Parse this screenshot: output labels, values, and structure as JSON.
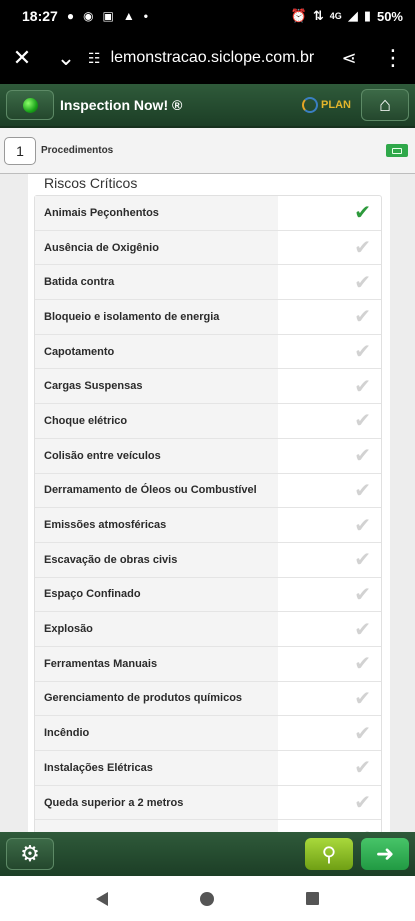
{
  "status": {
    "time": "18:27",
    "network": "4G",
    "battery": "50%"
  },
  "browser": {
    "url": "lemonstracao.siclope.com.br"
  },
  "header": {
    "title": "Inspection Now! ®",
    "brand": "PLAN"
  },
  "subheader": {
    "step": "1",
    "label": "Procedimentos"
  },
  "section": {
    "title": "Riscos Críticos"
  },
  "items": [
    {
      "label": "Animais Peçonhentos",
      "checked": true
    },
    {
      "label": "Ausência de Oxigênio",
      "checked": false
    },
    {
      "label": "Batida contra",
      "checked": false
    },
    {
      "label": "Bloqueio e isolamento de energia",
      "checked": false
    },
    {
      "label": "Capotamento",
      "checked": false
    },
    {
      "label": "Cargas Suspensas",
      "checked": false
    },
    {
      "label": "Choque elétrico",
      "checked": false
    },
    {
      "label": "Colisão entre veículos",
      "checked": false
    },
    {
      "label": "Derramamento de Óleos ou Combustível",
      "checked": false
    },
    {
      "label": "Emissões atmosféricas",
      "checked": false
    },
    {
      "label": "Escavação de obras civis",
      "checked": false
    },
    {
      "label": "Espaço Confinado",
      "checked": false
    },
    {
      "label": "Explosão",
      "checked": false
    },
    {
      "label": "Ferramentas Manuais",
      "checked": false
    },
    {
      "label": "Gerenciamento de produtos químicos",
      "checked": false
    },
    {
      "label": "Incêndio",
      "checked": false
    },
    {
      "label": "Instalações Elétricas",
      "checked": false
    },
    {
      "label": "Queda superior a 2 metros",
      "checked": false
    },
    {
      "label": "",
      "checked": false
    }
  ],
  "colors": {
    "header_green": "#2f5a3a",
    "check_on": "#2d9a3c",
    "check_off": "#d2d2d2"
  }
}
